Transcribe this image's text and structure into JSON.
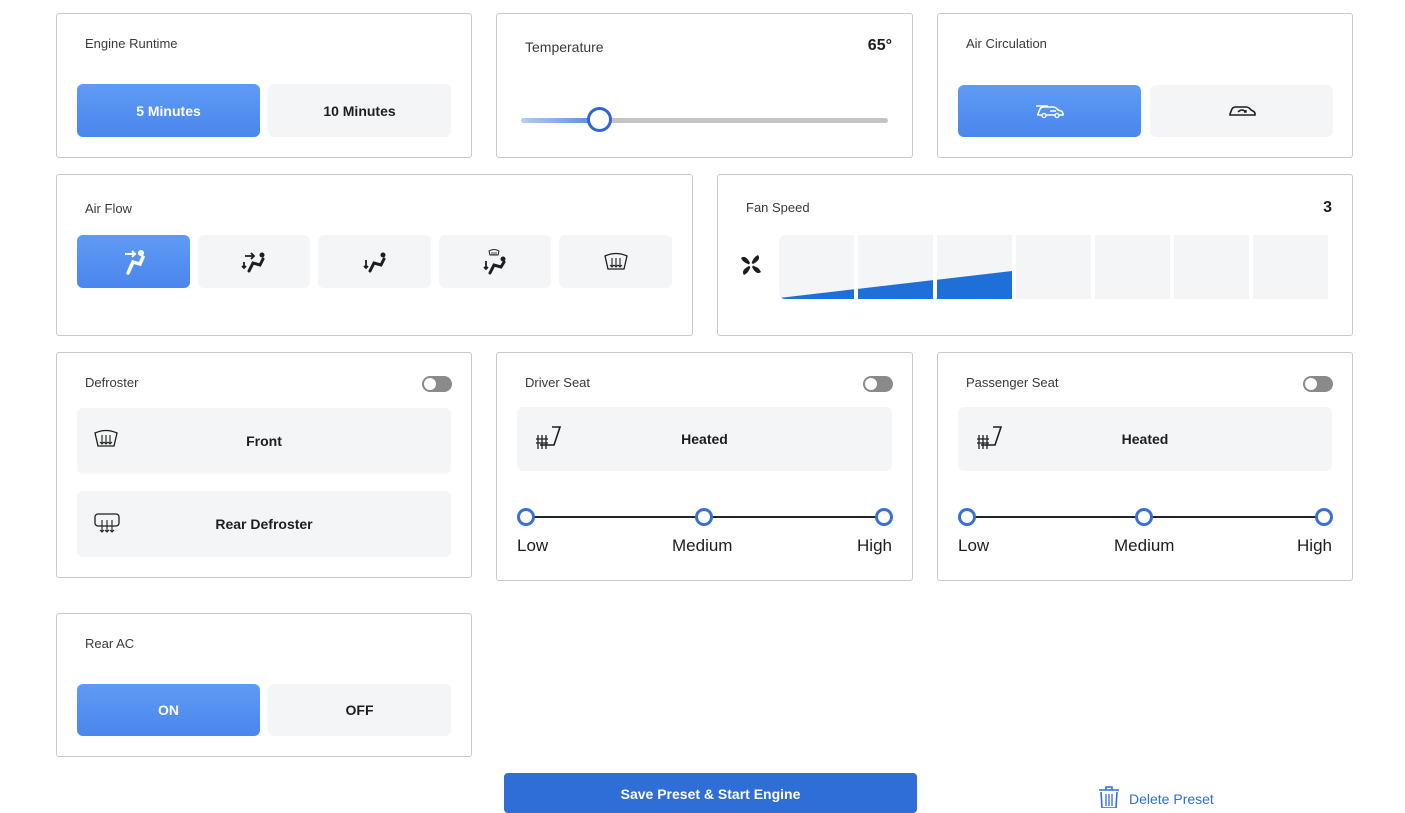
{
  "engine_runtime": {
    "title": "Engine Runtime",
    "options": [
      "5 Minutes",
      "10 Minutes"
    ],
    "selected": "5 Minutes"
  },
  "temperature": {
    "title": "Temperature",
    "value": "65°"
  },
  "air_circulation": {
    "title": "Air Circulation",
    "options_icons": [
      "car-fresh-air-icon",
      "car-recirculate-icon"
    ],
    "selected": "car-fresh-air-icon"
  },
  "air_flow": {
    "title": "Air Flow",
    "options_icons": [
      "vent-face-icon",
      "vent-face-feet-icon",
      "vent-feet-icon",
      "vent-feet-defrost-icon",
      "windshield-defrost-icon"
    ],
    "selected": "vent-face-icon"
  },
  "fan_speed": {
    "title": "Fan Speed",
    "value": "3",
    "level": 3,
    "max": 7
  },
  "defroster": {
    "title": "Defroster",
    "enabled": false,
    "front_label": "Front",
    "rear_label": "Rear Defroster"
  },
  "driver_seat": {
    "title": "Driver Seat",
    "enabled": false,
    "mode_label": "Heated",
    "levels": [
      "Low",
      "Medium",
      "High"
    ]
  },
  "passenger_seat": {
    "title": "Passenger Seat",
    "enabled": false,
    "mode_label": "Heated",
    "levels": [
      "Low",
      "Medium",
      "High"
    ]
  },
  "rear_ac": {
    "title": "Rear AC",
    "options": [
      "ON",
      "OFF"
    ],
    "selected": "ON"
  },
  "footer": {
    "save_label": "Save Preset & Start Engine",
    "delete_label": "Delete Preset"
  },
  "colors": {
    "accent": "#4a86ec",
    "primary_button": "#2f6ed6",
    "fan_fill": "#1f6fd8"
  }
}
